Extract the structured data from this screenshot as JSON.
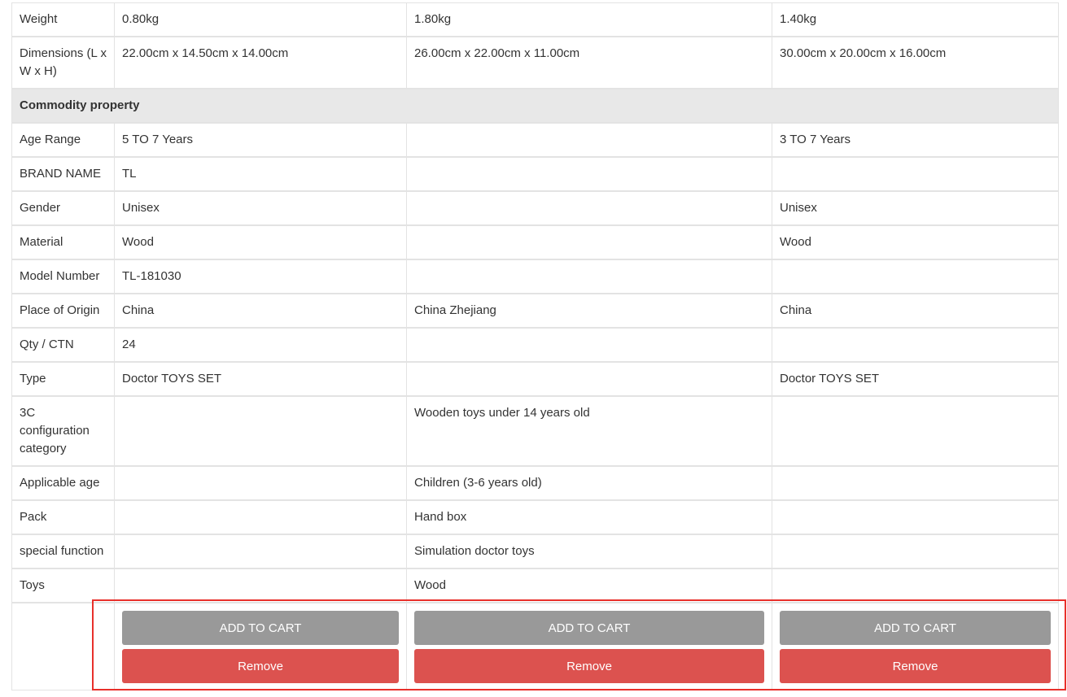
{
  "rows": [
    {
      "label": "Weight",
      "values": [
        "0.80kg",
        "1.80kg",
        "1.40kg"
      ]
    },
    {
      "label": "Dimensions (L x W x H)",
      "values": [
        "22.00cm x 14.50cm x 14.00cm",
        "26.00cm x 22.00cm x 11.00cm",
        "30.00cm x 20.00cm x 16.00cm"
      ]
    },
    {
      "section": "Commodity property"
    },
    {
      "label": "Age Range",
      "values": [
        "5 TO 7 Years",
        "",
        "3 TO 7 Years"
      ]
    },
    {
      "label": "BRAND NAME",
      "values": [
        "TL",
        "",
        ""
      ]
    },
    {
      "label": "Gender",
      "values": [
        "Unisex",
        "",
        "Unisex"
      ]
    },
    {
      "label": "Material",
      "values": [
        "Wood",
        "",
        "Wood"
      ]
    },
    {
      "label": "Model Number",
      "values": [
        "TL-181030",
        "",
        ""
      ]
    },
    {
      "label": "Place of Origin",
      "values": [
        "China",
        "China Zhejiang",
        "China"
      ]
    },
    {
      "label": "Qty / CTN",
      "values": [
        "24",
        "",
        ""
      ]
    },
    {
      "label": "Type",
      "values": [
        "Doctor TOYS SET",
        "",
        "Doctor TOYS SET"
      ]
    },
    {
      "label": "3C configuration category",
      "values": [
        "",
        "Wooden toys under 14 years old",
        ""
      ]
    },
    {
      "label": "Applicable age",
      "values": [
        "",
        "Children (3-6 years old)",
        ""
      ]
    },
    {
      "label": "Pack",
      "values": [
        "",
        "Hand box",
        ""
      ]
    },
    {
      "label": "special function",
      "values": [
        "",
        "Simulation doctor toys",
        ""
      ]
    },
    {
      "label": "Toys",
      "values": [
        "",
        "Wood",
        ""
      ]
    }
  ],
  "actions": {
    "add_to_cart_label": "ADD TO CART",
    "remove_label": "Remove"
  },
  "colors": {
    "add_to_cart_bg": "#999999",
    "remove_bg": "#dc524f",
    "section_bg": "#e8e8e8",
    "highlight_border": "#e8302b"
  }
}
